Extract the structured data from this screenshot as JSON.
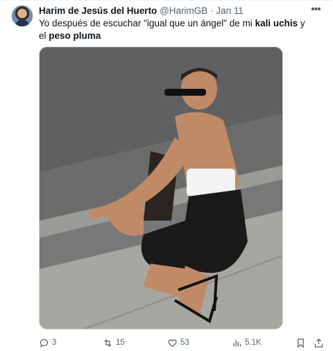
{
  "tweet": {
    "author_name": "Harim de Jesús del Huerto",
    "handle": "@HarimGB",
    "separator": "·",
    "date": "Jan 11",
    "more_label": "•••",
    "text_parts": {
      "p1": "Yo después de escuchar \"igual que un ángel\" de mi ",
      "b1": "kali uchis",
      "p2": " y el ",
      "b2": "peso pluma"
    }
  },
  "actions": {
    "replies": "3",
    "retweets": "15",
    "likes": "53",
    "views": "5.1K"
  },
  "colors": {
    "text": "#0f1419",
    "secondary": "#536471",
    "border": "#cfd9de"
  },
  "icons": [
    "more-icon",
    "reply-icon",
    "retweet-icon",
    "like-icon",
    "views-icon",
    "bookmark-icon",
    "share-icon"
  ]
}
